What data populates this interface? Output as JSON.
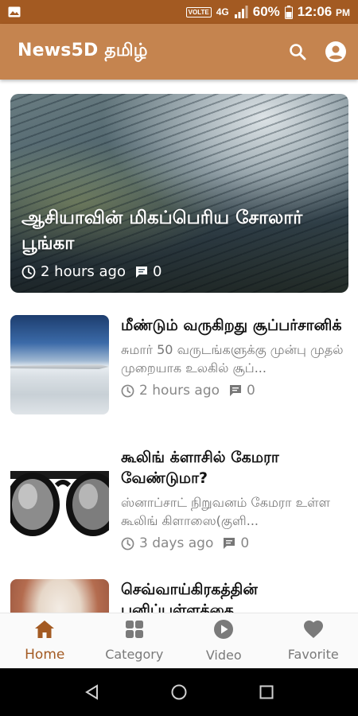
{
  "status_bar": {
    "volte": "VOLTE",
    "network": "4G",
    "battery": "60%",
    "time": "12:06",
    "ampm": "PM"
  },
  "app_bar": {
    "title": "News5D தமிழ்",
    "icons": [
      "search-icon",
      "account-icon"
    ]
  },
  "featured": {
    "title": "ஆசியாவின் மிகப்பெரிய சோலார் பூங்கா",
    "time": "2 hours ago",
    "comments": "0"
  },
  "articles": [
    {
      "headline": "மீண்டும் வருகிறது சூப்பர்சானிக்",
      "summary": "சுமார் 50 வருடங்களுக்கு முன்பு முதல் முறையாக உலகில் சூப்...",
      "time": "2 hours ago",
      "comments": "0"
    },
    {
      "headline": "கூலிங் க்ளாசில் கேமரா வேண்டுமா?",
      "summary": "ஸ்னாப்சாட் நிறுவனம் கேமரா உள்ள கூலிங் கிளாஸை(குளி...",
      "time": "3 days ago",
      "comments": "0"
    },
    {
      "headline": "செவ்வாய்கிரகத்தின் பனிப்பள்ளத்தை"
    }
  ],
  "bottom_nav": {
    "home": "Home",
    "category": "Category",
    "video": "Video",
    "favorite": "Favorite"
  },
  "colors": {
    "status_bar": "#a35a22",
    "app_bar": "#c5844f",
    "accent": "#a35a22"
  }
}
